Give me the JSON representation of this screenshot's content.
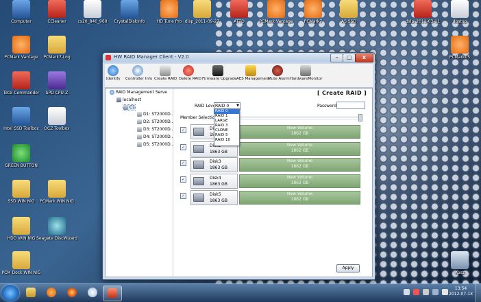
{
  "desktop": {
    "icons": [
      {
        "label": "Computer"
      },
      {
        "label": "CCleaner"
      },
      {
        "label": "cs20_840_960"
      },
      {
        "label": "CrystalDiskInfo"
      },
      {
        "label": "HD Tune Pro"
      },
      {
        "label": "disp_2011-09-27"
      },
      {
        "label": "ATTO"
      },
      {
        "label": "PCMark Vantage"
      },
      {
        "label": "PCMark7"
      },
      {
        "label": "AS SSD"
      },
      {
        "label": "dslp_2011-03-11"
      },
      {
        "label": "dbstop"
      },
      {
        "label": "PCMark Vantage"
      },
      {
        "label": "PCMark7-Log"
      },
      {
        "label": "PCMark05"
      },
      {
        "label": "Total Commander"
      },
      {
        "label": "SPD CPU-Z"
      },
      {
        "label": "Intel SSD Toolbox"
      },
      {
        "label": "OCZ Toolbox"
      },
      {
        "label": "GREEN BUTTON"
      },
      {
        "label": "SSD WIN NIG"
      },
      {
        "label": "PCMark WIN NIG"
      },
      {
        "label": "HDD WIN NIG"
      },
      {
        "label": "Seagate DiscWizard"
      },
      {
        "label": "PCM Dock WIN NIG"
      },
      {
        "label": "Kosz"
      }
    ]
  },
  "window": {
    "title": "HW RAID Manager Client - V2.0",
    "controls": {
      "minimize": "–",
      "maximize": "□",
      "close": "x"
    },
    "toolbar": [
      {
        "label": "Identify"
      },
      {
        "label": "Controller Info"
      },
      {
        "label": "Create RAID"
      },
      {
        "label": "Delete RAID"
      },
      {
        "label": "Firmware Upgrade"
      },
      {
        "label": "AES Management"
      },
      {
        "label": "Mute Alarm"
      },
      {
        "label": "HardwareMonitor"
      }
    ],
    "tree": {
      "root": "RAID Management Serve",
      "host": "localhost",
      "controller": "C1",
      "disks": [
        "D1: ST2000D...",
        "D2: ST2000D...",
        "D3: ST2000D...",
        "D4: ST2000D...",
        "D5: ST2000D..."
      ]
    },
    "panel": {
      "heading": "[ Create RAID ]",
      "raid_level_label": "RAID Level",
      "raid_level_value": "RAID 0",
      "raid_options": [
        "RAID 0",
        "RAID 1",
        "LARGE",
        "RAID 3",
        "CLONE",
        "RAID 5",
        "RAID 10"
      ],
      "password_label": "Password",
      "member_label": "Member Selection",
      "disks": [
        {
          "name": "Disk1",
          "size": "1863 GB",
          "volume_name": "New Volume",
          "volume_size": "1862 GB"
        },
        {
          "name": "Disk2",
          "size": "1863 GB",
          "volume_name": "New Volume",
          "volume_size": "1862 GB"
        },
        {
          "name": "Disk3",
          "size": "1863 GB",
          "volume_name": "New Volume",
          "volume_size": "1862 GB"
        },
        {
          "name": "Disk4",
          "size": "1863 GB",
          "volume_name": "New Volume",
          "volume_size": "1862 GB"
        },
        {
          "name": "Disk5",
          "size": "1863 GB",
          "volume_name": "New Volume",
          "volume_size": "1862 GB"
        }
      ],
      "check_mark": "✓",
      "apply_label": "Apply"
    }
  },
  "taskbar": {
    "clock_time": "13:54",
    "clock_date": "2012-07-13"
  }
}
